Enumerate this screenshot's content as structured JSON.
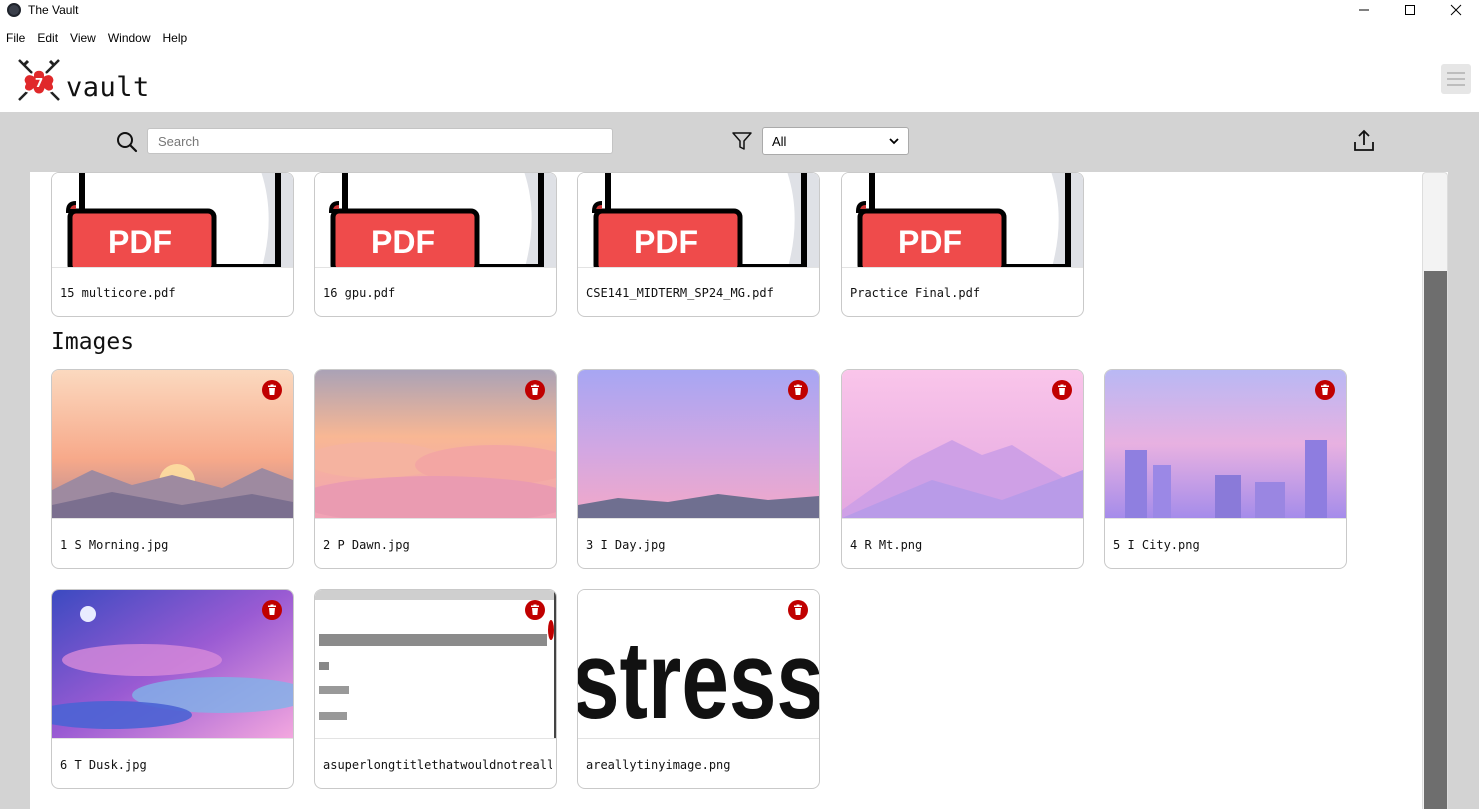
{
  "window": {
    "title": "The Vault",
    "controls": {
      "minimize": "—",
      "maximize": "☐",
      "close": "✕"
    }
  },
  "menu": [
    "File",
    "Edit",
    "View",
    "Window",
    "Help"
  ],
  "header": {
    "logo_text": "vault"
  },
  "toolbar": {
    "search_placeholder": "Search",
    "filter_value": "All"
  },
  "documents": [
    {
      "name": "15 multicore.pdf"
    },
    {
      "name": "16 gpu.pdf"
    },
    {
      "name": "CSE141_MIDTERM_SP24_MG.pdf"
    },
    {
      "name": "Practice Final.pdf"
    }
  ],
  "pdf_badge": "PDF",
  "images_section": {
    "title": "Images",
    "items": [
      {
        "name": "1 S Morning.jpg",
        "palette": [
          "#f6c6a6",
          "#f9a57f",
          "#c98a8f"
        ]
      },
      {
        "name": "2 P Dawn.jpg",
        "palette": [
          "#b3a9b8",
          "#f7b392",
          "#f3a3b4"
        ]
      },
      {
        "name": "3 I Day.jpg",
        "palette": [
          "#a9a8f2",
          "#c5a6e6",
          "#f1a7c5"
        ]
      },
      {
        "name": "4 R Mt.png",
        "palette": [
          "#f6bfe6",
          "#e7a8dc",
          "#c9a3ee"
        ]
      },
      {
        "name": "5 I City.png",
        "palette": [
          "#b6b6f2",
          "#e6b0e0",
          "#9c86e8"
        ]
      },
      {
        "name": "6 T Dusk.jpg",
        "palette": [
          "#3e4ec2",
          "#8e56cf",
          "#f6a8e0"
        ]
      },
      {
        "name": "asuperlongtitlethatwouldnotreallyfit.png"
      },
      {
        "name": "areallytinyimage.png",
        "thumb_text": "stress"
      }
    ]
  },
  "colors": {
    "toolbar_bg": "#d3d3d3",
    "trash_red": "#c00000",
    "pdf_red": "#ef4b4b"
  }
}
